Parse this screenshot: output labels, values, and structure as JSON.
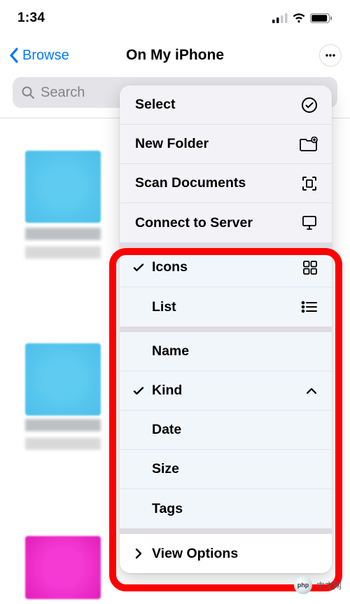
{
  "status": {
    "time": "1:34"
  },
  "nav": {
    "back": "Browse",
    "title": "On My iPhone"
  },
  "search": {
    "placeholder": "Search"
  },
  "menu_top": {
    "select": "Select",
    "new_folder": "New Folder",
    "scan": "Scan Documents",
    "connect": "Connect to Server"
  },
  "view": {
    "icons": "Icons",
    "list": "List"
  },
  "sort": {
    "name": "Name",
    "kind": "Kind",
    "date": "Date",
    "size": "Size",
    "tags": "Tags"
  },
  "view_options": "View Options",
  "watermark": {
    "logo": "php",
    "text": "中文网"
  }
}
